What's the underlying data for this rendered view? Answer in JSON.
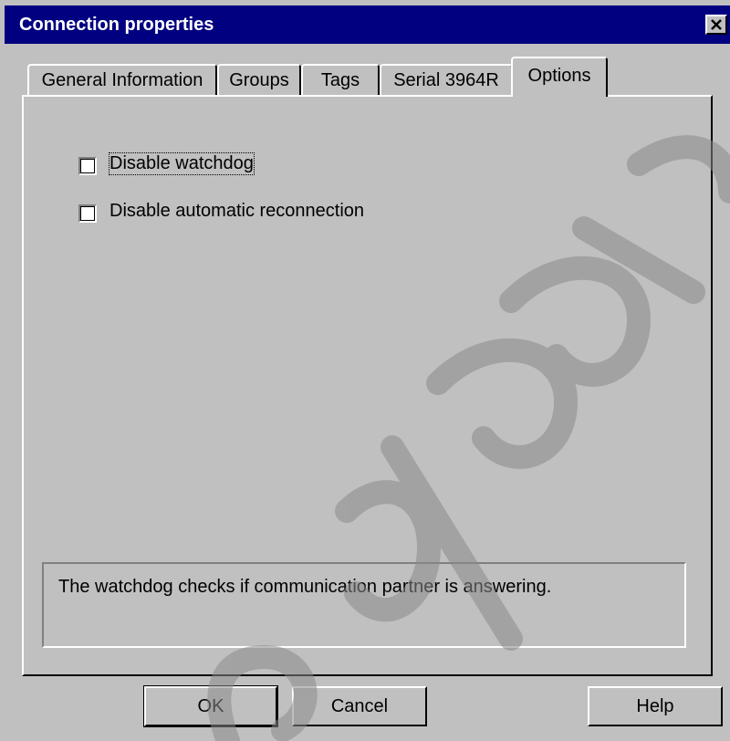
{
  "window": {
    "title": "Connection properties",
    "close_glyph": "✕"
  },
  "tabs": [
    {
      "label": "General Information",
      "active": false
    },
    {
      "label": "Groups",
      "active": false
    },
    {
      "label": "Tags",
      "active": false
    },
    {
      "label": "Serial 3964R",
      "active": false
    },
    {
      "label": "Options",
      "active": true
    }
  ],
  "options": {
    "disable_watchdog": {
      "label": "Disable watchdog",
      "checked": false
    },
    "disable_reconnection": {
      "label": "Disable automatic reconnection",
      "checked": false
    }
  },
  "description": "The watchdog checks if communication partner is answering.",
  "buttons": {
    "ok": "OK",
    "cancel": "Cancel",
    "help": "Help"
  },
  "colors": {
    "titlebar": "#000080",
    "face": "#c0c0c0"
  }
}
